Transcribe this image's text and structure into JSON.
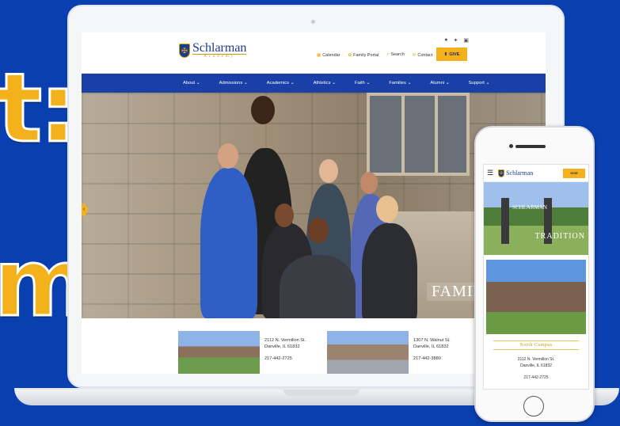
{
  "side_text": {
    "line1": "t:",
    "line2": "m"
  },
  "brand": {
    "name": "Schlarman",
    "sub": "Academy"
  },
  "social_icons": [
    "facebook-icon",
    "twitter-icon",
    "instagram-icon"
  ],
  "utility": {
    "calendar": "Calendar",
    "family_portal": "Family Portal",
    "search": "Search",
    "contact": "Contact",
    "give": "GIVE"
  },
  "nav": [
    {
      "label": "About ⌄"
    },
    {
      "label": "Admissions ⌄"
    },
    {
      "label": "Academics ⌄"
    },
    {
      "label": "Athletics ⌄"
    },
    {
      "label": "Faith ⌄"
    },
    {
      "label": "Families ⌄"
    },
    {
      "label": "Alumni ⌄"
    },
    {
      "label": "Support ⌄"
    }
  ],
  "hero": {
    "caption": "FAMILI"
  },
  "campuses": [
    {
      "address1": "2112 N. Vermilion St.",
      "address2": "Danville, IL 61832",
      "phone": "217-442-2725"
    },
    {
      "address1": "1307 N. Walnut St.",
      "address2": "Danville, IL 61832",
      "phone": "217-442-3880"
    }
  ],
  "mobile": {
    "give": "GIVE",
    "tradition_caption": "TRADITION",
    "sign_text": "SCHLARMAN",
    "campus_title": "North Campus",
    "address1": "2112 N. Vermilion St.",
    "address2": "Danville, IL 61832",
    "phone": "217-442-2725"
  },
  "colors": {
    "brand_blue": "#1a3fa6",
    "gold": "#f3b21b",
    "background": "#0a3fb0"
  }
}
